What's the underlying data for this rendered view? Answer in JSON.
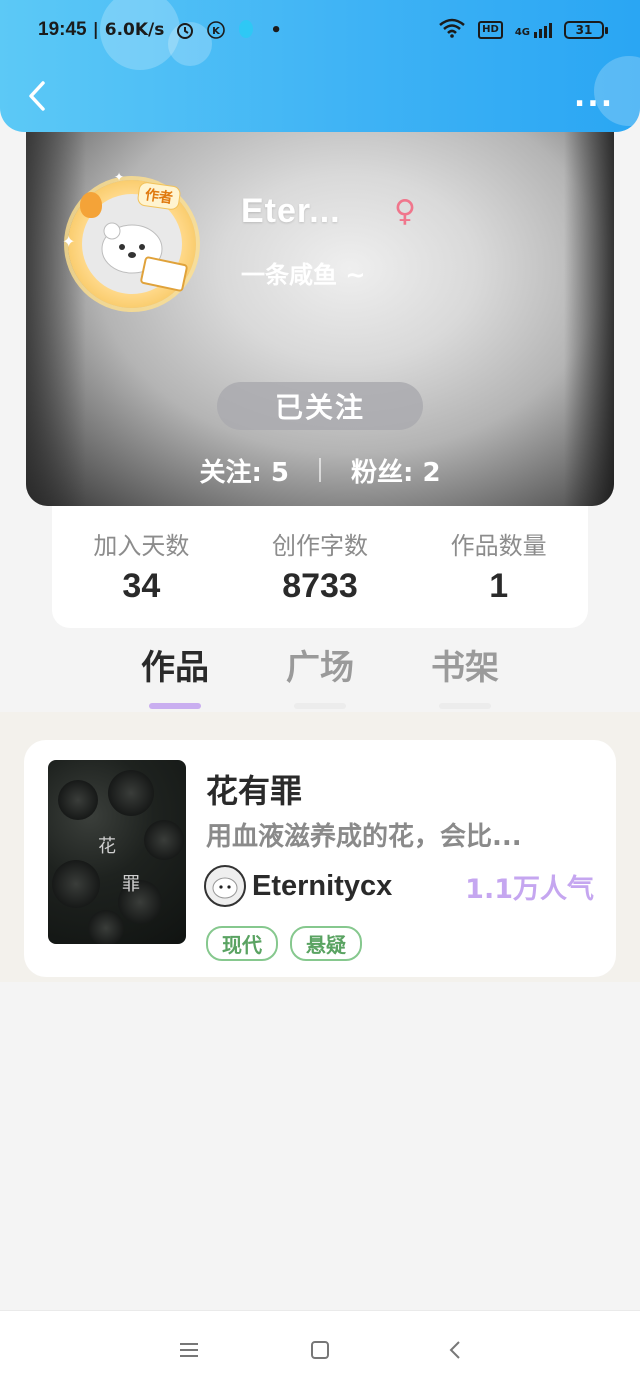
{
  "status_bar": {
    "time": "19:45",
    "speed": "| 6.0K/s",
    "network": "4G",
    "hd": "HD",
    "battery": "31"
  },
  "header": {
    "back_icon": "chevron-left-icon",
    "more_label": "..."
  },
  "profile": {
    "name": "Eter...",
    "gender_icon": "♀",
    "signature": "一条咸鱼 ~",
    "badge": "作者",
    "follow_button": "已关注",
    "following_label": "关注: 5",
    "fans_label": "粉丝: 2"
  },
  "stats": [
    {
      "label": "加入天数",
      "value": "34"
    },
    {
      "label": "创作字数",
      "value": "8733"
    },
    {
      "label": "作品数量",
      "value": "1"
    }
  ],
  "tabs": [
    {
      "label": "作品",
      "active": true
    },
    {
      "label": "广场",
      "active": false
    },
    {
      "label": "书架",
      "active": false
    }
  ],
  "works": [
    {
      "title": "花有罪",
      "description": "用血液滋养成的花，会比...",
      "author": "Eternitycx",
      "popularity": "1.1万人气",
      "tags": [
        "现代",
        "悬疑"
      ],
      "cover_text": [
        "花",
        "罪"
      ]
    }
  ],
  "colors": {
    "header_blue": "#3fb3f5",
    "accent_purple": "#c9aef0",
    "tag_green": "#5aa362",
    "gender_pink": "#f0768c"
  }
}
